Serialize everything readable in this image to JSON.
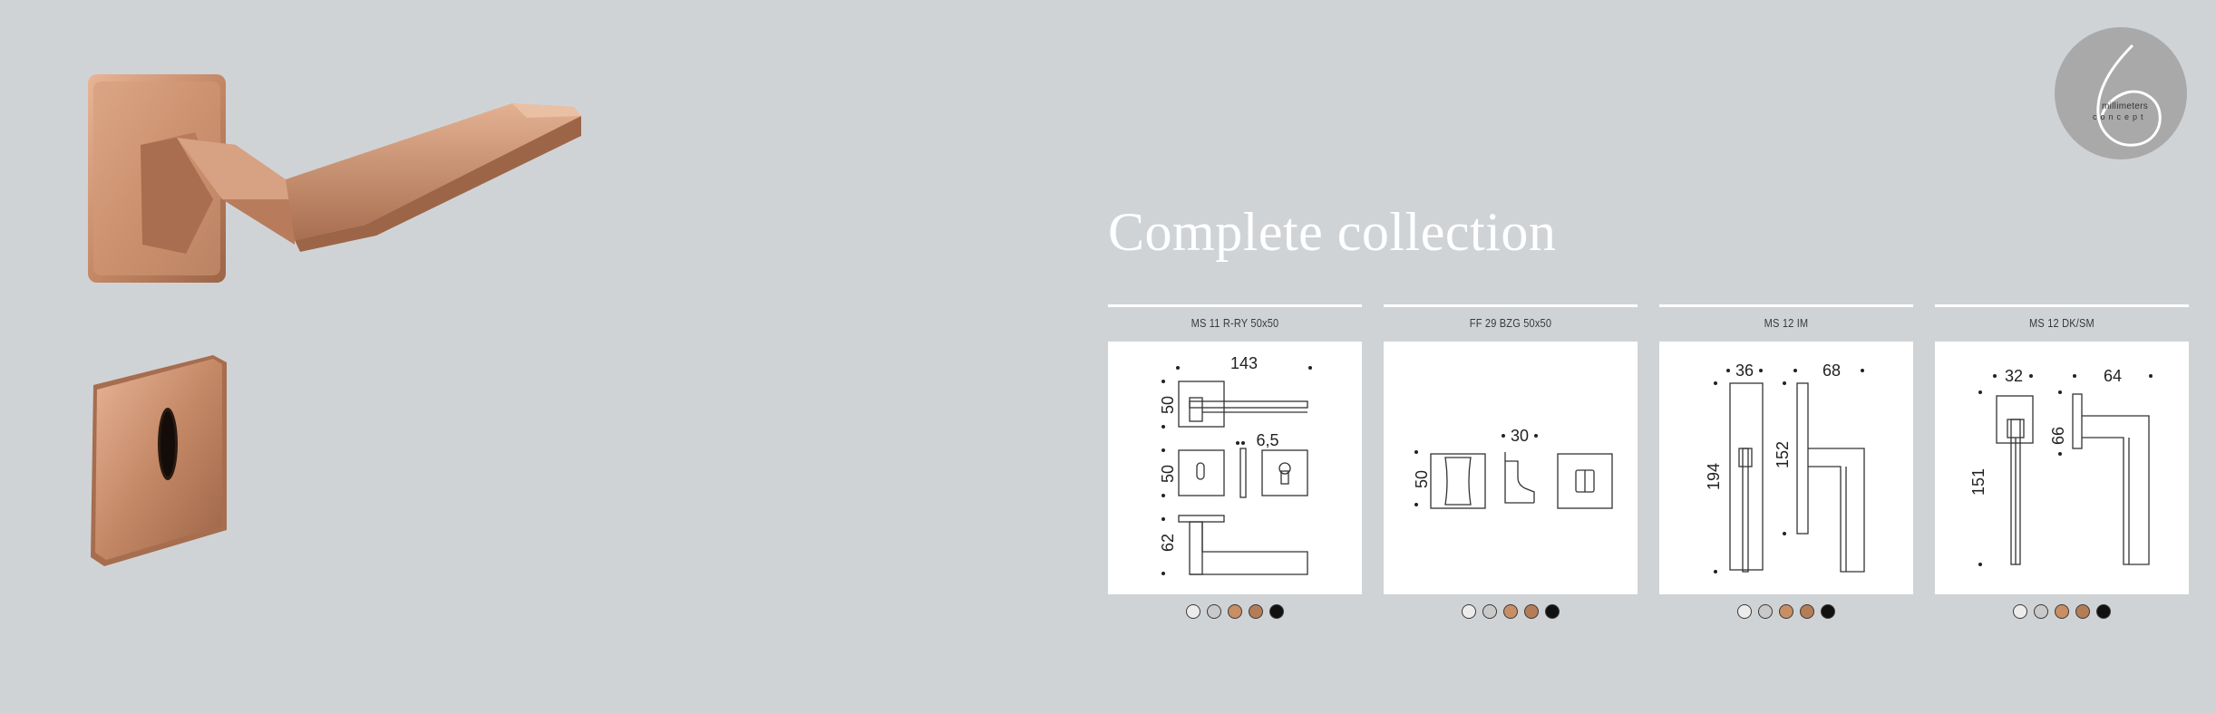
{
  "title": "Complete collection",
  "logo": {
    "line1": "millimeters",
    "line2": "concept",
    "numeral": "6"
  },
  "finish_colors": [
    "#ececec",
    "#c9c9c9",
    "#c98e63",
    "#b57d55",
    "#111111"
  ],
  "cards": [
    {
      "code": "MS 11 R-RY 50x50",
      "dims": {
        "width": "143",
        "rose_top": "50",
        "rose_mid": "50",
        "rose_low": "62",
        "spindle": "6,5"
      }
    },
    {
      "code": "FF 29 BZG 50x50",
      "dims": {
        "depth": "30",
        "height": "50"
      }
    },
    {
      "code": "MS 12 IM",
      "dims": {
        "small_width": "36",
        "large_width": "68",
        "small_height": "194",
        "large_height": "152"
      }
    },
    {
      "code": "MS 12 DK/SM",
      "dims": {
        "small_width": "32",
        "large_width": "64",
        "small_height": "151",
        "large_height": "66"
      }
    }
  ]
}
